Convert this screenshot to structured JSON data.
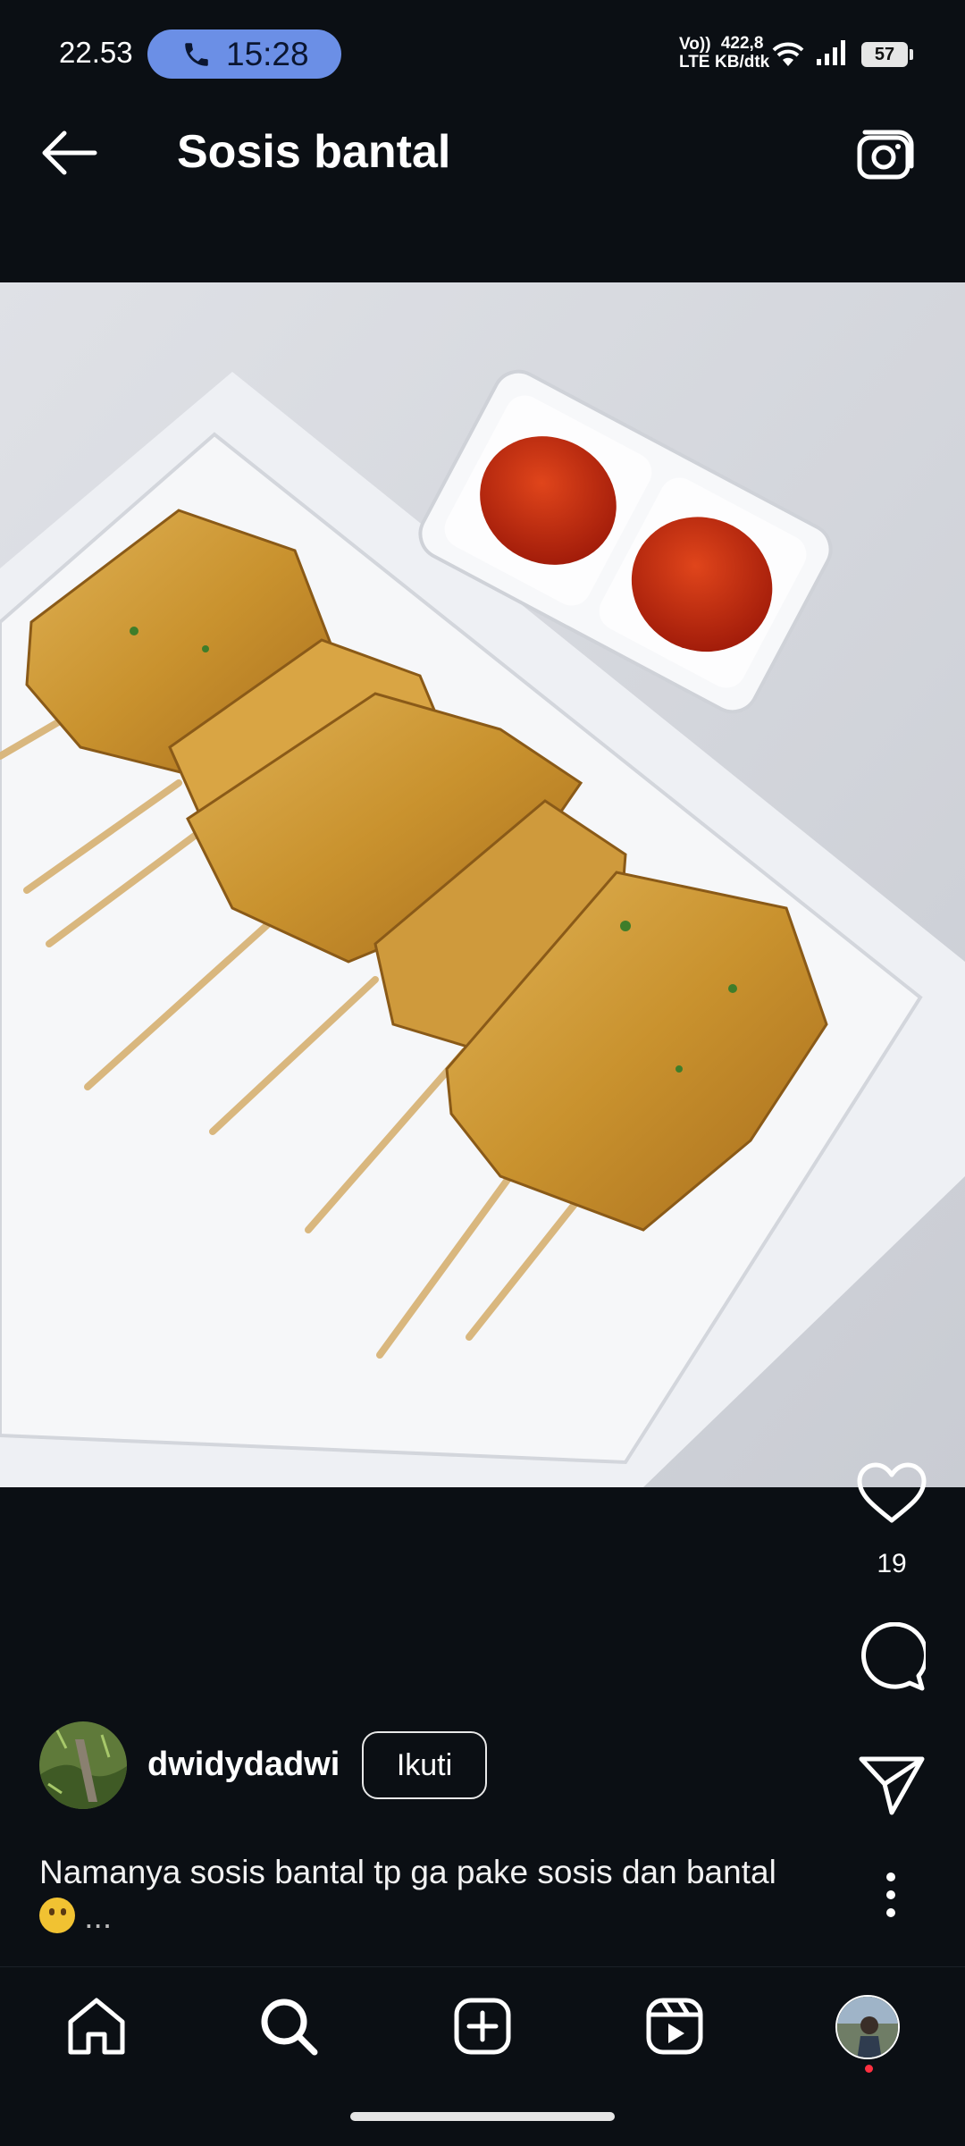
{
  "status_bar": {
    "time": "22.53",
    "call_duration": "15:28",
    "network_label": "Vo)) LTE",
    "speed_value": "422,8",
    "speed_unit": "KB/dtk",
    "battery": "57",
    "icons": [
      "phone-icon",
      "wifi-icon",
      "signal-icon",
      "battery-icon"
    ]
  },
  "header": {
    "title": "Sosis bantal",
    "back_icon": "arrow-left-icon",
    "camera_icon": "camera-icon"
  },
  "post": {
    "image_alt": "fried sausage skewers on white plate with chili sauce",
    "like_count": "19",
    "author": {
      "username": "dwidydadwi",
      "follow_label": "Ikuti"
    },
    "caption_text": "Namanya sosis bantal tp ga pake sosis dan bantal",
    "caption_more": "...",
    "actions": [
      "heart-icon",
      "comment-icon",
      "send-icon",
      "more-icon"
    ]
  },
  "bottom_nav": {
    "items": [
      "home-icon",
      "search-icon",
      "add-icon",
      "reels-icon",
      "profile-avatar"
    ]
  },
  "colors": {
    "background": "#0b0f14",
    "call_pill": "#6b8fe6",
    "notification_dot": "#ff3040"
  }
}
